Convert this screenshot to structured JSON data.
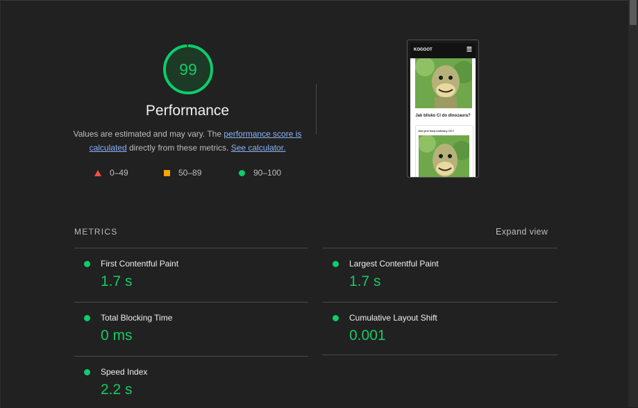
{
  "score": {
    "value": "99",
    "title": "Performance"
  },
  "description": {
    "text1": "Values are estimated and may vary. The ",
    "link1": "performance score is calculated",
    "text2": " directly from these metrics. ",
    "link2": "See calculator."
  },
  "legend": [
    {
      "range": "0–49",
      "icon": "triangle-icon",
      "color": "#ff4e42"
    },
    {
      "range": "50–89",
      "icon": "square-icon",
      "color": "#ffa400"
    },
    {
      "range": "90–100",
      "icon": "circle-icon",
      "color": "#0cce6b"
    }
  ],
  "screenshot": {
    "brand": "KOGOOT",
    "question": "Jak blisko Ci do dinozaura?",
    "card_title": "Jaki jest twój ulubiony OC?"
  },
  "metrics": {
    "heading": "METRICS",
    "expand": "Expand view",
    "items": [
      {
        "label": "First Contentful Paint",
        "value": "1.7 s"
      },
      {
        "label": "Largest Contentful Paint",
        "value": "1.7 s"
      },
      {
        "label": "Total Blocking Time",
        "value": "0 ms"
      },
      {
        "label": "Cumulative Layout Shift",
        "value": "0.001"
      },
      {
        "label": "Speed Index",
        "value": "2.2 s"
      }
    ]
  },
  "colors": {
    "pass": "#0cce6b",
    "average": "#ffa400",
    "fail": "#ff4e42",
    "link": "#8ab4f8"
  }
}
